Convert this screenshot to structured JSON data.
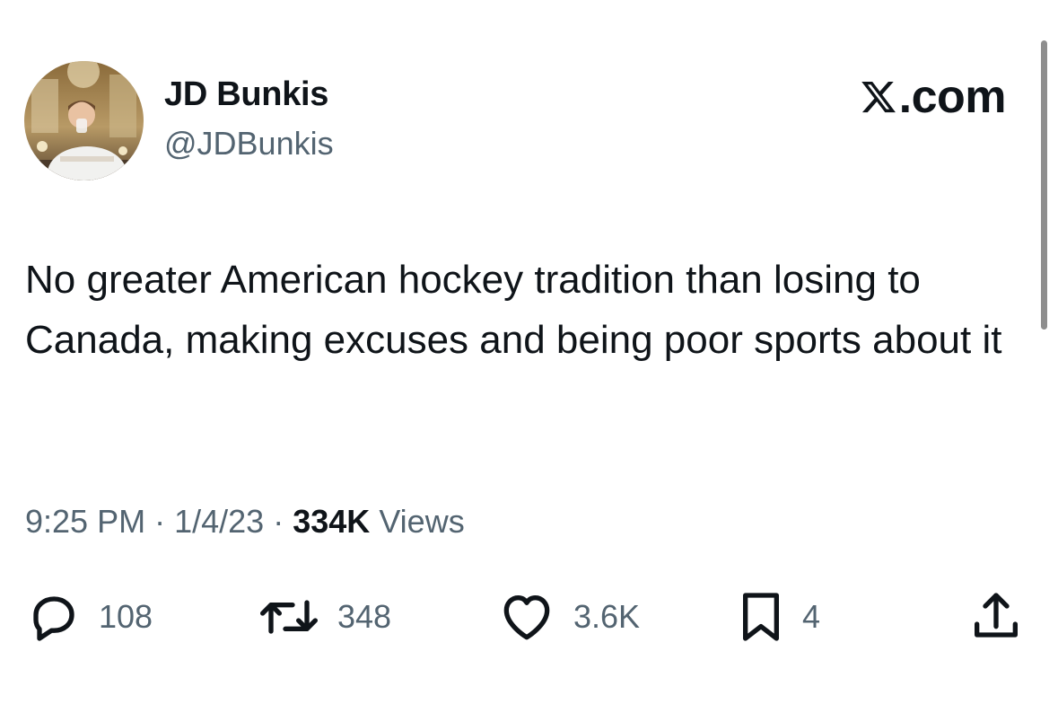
{
  "tweet": {
    "author_name": "JD Bunkis",
    "author_handle": "@JDBunkis",
    "site_label": ".com",
    "text": "No greater American hockey tradition than losing to Canada, making excuses and being poor sports about it",
    "time": "9:25 PM",
    "separator": "·",
    "date": "1/4/23",
    "views_count": "334K",
    "views_label": "Views"
  },
  "actions": {
    "replies": "108",
    "reposts": "348",
    "likes": "3.6K",
    "bookmarks": "4"
  },
  "icons": {
    "logo": "x-logo-icon",
    "reply": "reply-icon",
    "repost": "repost-icon",
    "like": "heart-icon",
    "bookmark": "bookmark-icon",
    "share": "share-icon"
  },
  "colors": {
    "text_primary": "#0f1419",
    "text_secondary": "#536471",
    "background": "#ffffff"
  }
}
